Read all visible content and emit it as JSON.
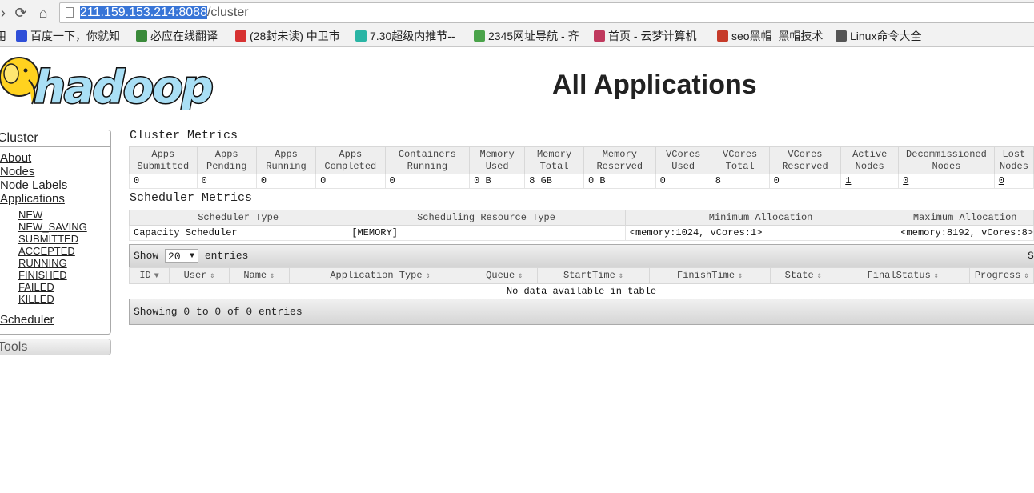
{
  "browser": {
    "url_host": "211.159.153.214:8088",
    "url_path": "/cluster",
    "bookmarks": [
      {
        "label": "用",
        "icon": "apps-icon",
        "color": "#4a7fd6"
      },
      {
        "label": "百度一下，你就知",
        "icon": "baidu-paw-icon",
        "color": "#2f4fd8"
      },
      {
        "label": "必应在线翻译",
        "icon": "translate-icon",
        "color": "#3a8a3a"
      },
      {
        "label": "(28封未读) 中卫市",
        "icon": "mail-icon",
        "color": "#d73232"
      },
      {
        "label": "7.30超级内推节--",
        "icon": "circle-icon",
        "color": "#2ab5a5"
      },
      {
        "label": "2345网址导航 - 齐",
        "icon": "house-icon",
        "color": "#4aa34a"
      },
      {
        "label": "首页 - 云梦计算机",
        "icon": "site-icon",
        "color": "#c0395e"
      },
      {
        "label": "seo黑帽_黑帽技术",
        "icon": "shield-icon",
        "color": "#c63b2a"
      },
      {
        "label": "Linux命令大全",
        "icon": "linux-icon",
        "color": "#555555"
      }
    ]
  },
  "header": {
    "logo_text": "hadoop",
    "title": "All Applications"
  },
  "sidebar": {
    "heading": "Cluster",
    "links": [
      "About",
      "Nodes",
      "Node Labels",
      "Applications"
    ],
    "app_states": [
      "NEW",
      "NEW_SAVING",
      "SUBMITTED",
      "ACCEPTED",
      "RUNNING",
      "FINISHED",
      "FAILED",
      "KILLED"
    ],
    "scheduler": "Scheduler",
    "tools": "Tools"
  },
  "cluster_metrics": {
    "label": "Cluster Metrics",
    "headers": [
      [
        "Apps",
        "Submitted"
      ],
      [
        "Apps",
        "Pending"
      ],
      [
        "Apps",
        "Running"
      ],
      [
        "Apps",
        "Completed"
      ],
      [
        "Containers",
        "Running"
      ],
      [
        "Memory",
        "Used"
      ],
      [
        "Memory",
        "Total"
      ],
      [
        "Memory",
        "Reserved"
      ],
      [
        "VCores",
        "Used"
      ],
      [
        "VCores",
        "Total"
      ],
      [
        "VCores",
        "Reserved"
      ],
      [
        "Active",
        "Nodes"
      ],
      [
        "Decommissioned",
        "Nodes"
      ],
      [
        "Lost",
        "Nodes"
      ]
    ],
    "values": [
      "0",
      "0",
      "0",
      "0",
      "0",
      "0 B",
      "8 GB",
      "0 B",
      "0",
      "8",
      "0",
      "1",
      "0",
      "0"
    ]
  },
  "scheduler_metrics": {
    "label": "Scheduler Metrics",
    "headers": [
      "Scheduler Type",
      "Scheduling Resource Type",
      "Minimum Allocation",
      "Maximum Allocation"
    ],
    "values": [
      "Capacity Scheduler",
      "[MEMORY]",
      "<memory:1024, vCores:1>",
      "<memory:8192, vCores:8>"
    ]
  },
  "apps_table": {
    "show_label": "Show",
    "page_size": "20",
    "entries_label": "entries",
    "search_label": "Search:",
    "columns": [
      "ID",
      "User",
      "Name",
      "Application Type",
      "Queue",
      "StartTime",
      "FinishTime",
      "State",
      "FinalStatus",
      "Progress"
    ],
    "empty_message": "No data available in table",
    "info": "Showing 0 to 0 of 0 entries"
  }
}
